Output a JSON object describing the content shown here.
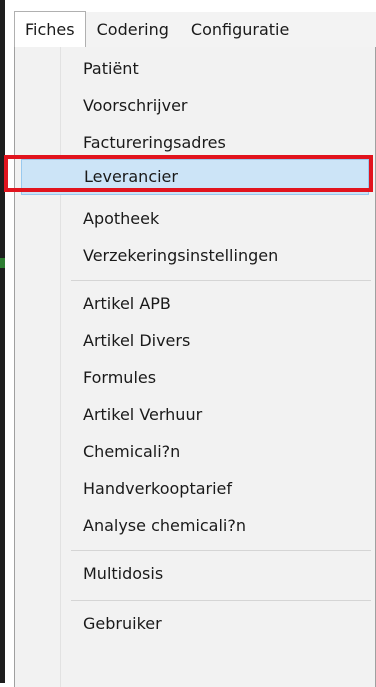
{
  "menubar": {
    "items": [
      {
        "label": "Fiches",
        "open": true
      },
      {
        "label": "Codering",
        "open": false
      },
      {
        "label": "Configuratie",
        "open": false
      }
    ]
  },
  "dropdown": {
    "items": [
      {
        "label": "Patiënt"
      },
      {
        "label": "Voorschrijver"
      },
      {
        "label": "Factureringsadres"
      },
      {
        "label": "Leverancier",
        "selected": true
      },
      {
        "label": "Apotheek"
      },
      {
        "label": "Verzekeringsinstellingen"
      },
      {
        "label": "Artikel APB"
      },
      {
        "label": "Artikel Divers"
      },
      {
        "label": "Formules"
      },
      {
        "label": "Artikel Verhuur"
      },
      {
        "label": "Chemicali?n"
      },
      {
        "label": "Handverkooptarief"
      },
      {
        "label": "Analyse chemicali?n"
      },
      {
        "label": "Multidosis"
      },
      {
        "label": "Gebruiker"
      }
    ]
  },
  "colors": {
    "highlight_border": "#e1141e",
    "selected_background": "#cce4f7"
  }
}
